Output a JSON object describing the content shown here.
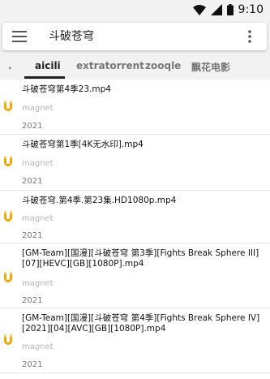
{
  "status": {
    "time": "9:10"
  },
  "search": {
    "query": "斗破苍穹"
  },
  "tabs": [
    {
      "label": "."
    },
    {
      "label": "aicili"
    },
    {
      "label": "extratorrent"
    },
    {
      "label": "zooqle"
    },
    {
      "label": "飘花电影"
    }
  ],
  "results": [
    {
      "title": "斗破苍穹第4季23.mp4",
      "type": "magnet",
      "year": "2021"
    },
    {
      "title": "斗破苍穹第1季[4K无水印].mp4",
      "type": "magnet",
      "year": "2021"
    },
    {
      "title": "斗破苍穹.第4季.第23集.HD1080p.mp4",
      "type": "magnet",
      "year": "2021"
    },
    {
      "title": "[GM-Team][国漫][斗破苍穹 第3季][Fights Break Sphere III][07][HEVC][GB][1080P].mp4",
      "type": "magnet",
      "year": "2021"
    },
    {
      "title": "[GM-Team][国漫][斗破苍穹 第4季][Fights Break Sphere IV][2021][04][AVC][GB][1080P].mp4",
      "type": "magnet",
      "year": "2021"
    }
  ],
  "colors": {
    "magnet_icon": "#f0a800",
    "accent": "#222222"
  }
}
